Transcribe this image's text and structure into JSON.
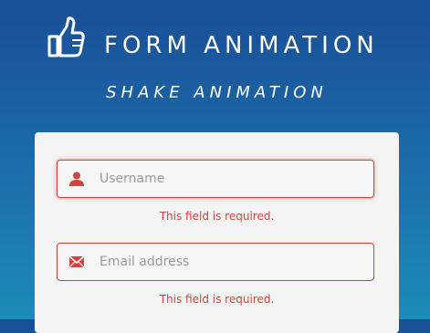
{
  "header": {
    "logo_icon": "thumbs-up-icon",
    "title": "FORM ANIMATION",
    "subtitle": "SHAKE ANIMATION"
  },
  "form": {
    "username": {
      "icon": "user-icon",
      "placeholder": "Username",
      "value": "",
      "error": "This field is required."
    },
    "email": {
      "icon": "envelope-icon",
      "placeholder": "Email address",
      "value": "",
      "error": "This field is required."
    }
  },
  "colors": {
    "background_top": "#1a4e97",
    "background_bottom": "#1b8cb8",
    "card": "#f4f4f4",
    "error": "#d2433b"
  }
}
